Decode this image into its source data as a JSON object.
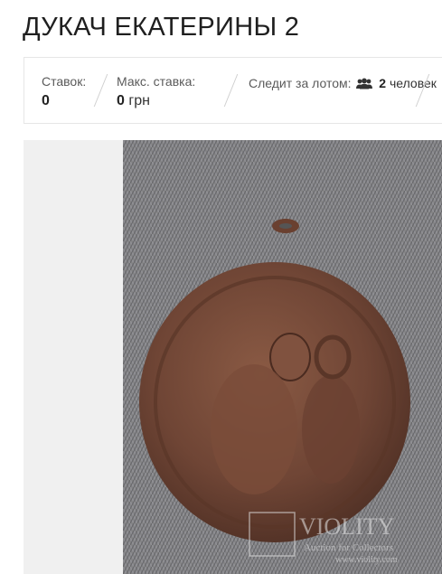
{
  "lot": {
    "title": "ДУКАЧ ЕКАТЕРИНЫ 2"
  },
  "stats": {
    "bids_label": "Ставок:",
    "bids_value": "0",
    "max_bid_label": "Макс. ставка:",
    "max_bid_value": "0",
    "max_bid_unit": "грн",
    "watch_label": "Следит за лотом:",
    "watch_count": "2",
    "watch_unit": "человек",
    "users_icon": "users-icon"
  },
  "watermark": {
    "brand": "VIOLITY",
    "tagline": "Auction for Collectors",
    "url": "www.violity.com"
  },
  "colors": {
    "page_bg": "#ffffff",
    "gallery_bg": "#f0f0f0",
    "text_dark": "#1f1f1f",
    "label_gray": "#5a5a5a"
  }
}
